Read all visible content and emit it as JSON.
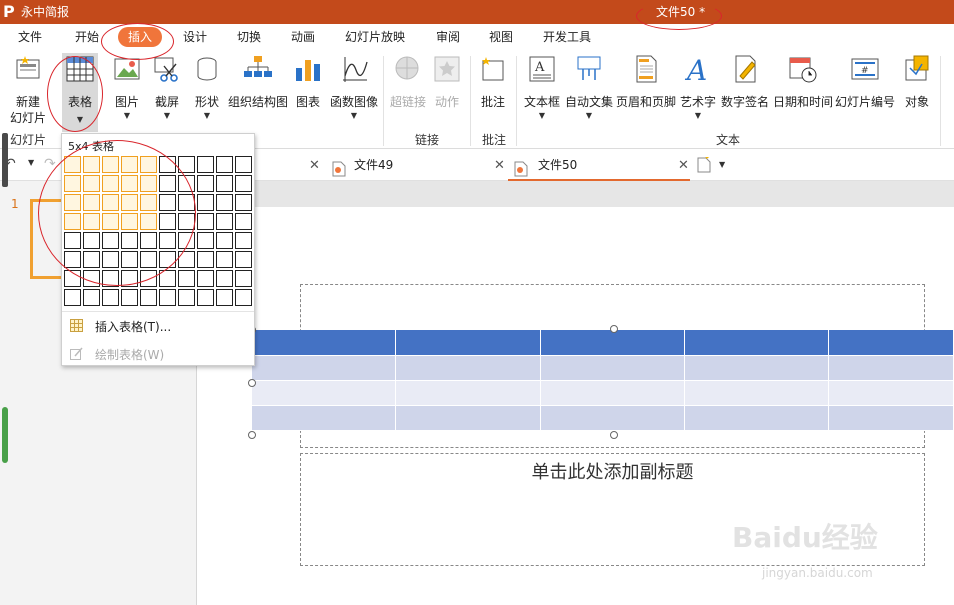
{
  "app": {
    "name": "永中简报",
    "document_title": "文件50 *"
  },
  "menu": {
    "tabs": [
      "文件",
      "开始",
      "插入",
      "设计",
      "切换",
      "动画",
      "幻灯片放映",
      "审阅",
      "视图",
      "开发工具"
    ],
    "active": "插入"
  },
  "ribbon": {
    "new_slide_line1": "新建",
    "new_slide_line2": "幻灯片",
    "table": "表格",
    "picture": "图片",
    "screenshot": "截屏",
    "shape": "形状",
    "smartart": "组织结构图",
    "chart": "图表",
    "function_graph": "函数图像",
    "hyperlink": "超链接",
    "action": "动作",
    "comment": "批注",
    "textbox": "文本框",
    "autotext": "自动文集",
    "header_footer": "页眉和页脚",
    "wordart": "艺术字",
    "signature": "数字签名",
    "datetime": "日期和时间",
    "slide_number": "幻灯片编号",
    "object": "对象",
    "groups": {
      "slides": "幻灯片",
      "links": "链接",
      "comments": "批注",
      "text": "文本"
    }
  },
  "doc_tabs": [
    {
      "label": "文件49"
    },
    {
      "label": "文件50"
    }
  ],
  "slide_number": "1",
  "table_dropdown": {
    "header": "5x4 表格",
    "grid": {
      "cols": 10,
      "rows": 8,
      "selected_cols": 5,
      "selected_rows": 4
    },
    "insert_table": "插入表格(T)...",
    "draw_table": "绘制表格(W)"
  },
  "slide": {
    "subtitle_placeholder": "单击此处添加副标题",
    "colors": {
      "header_row": "#4472c4",
      "row_dark": "#cfd5ea",
      "row_light": "#e9ebf5"
    }
  },
  "watermark": {
    "line1": "Baidu经验",
    "line2": "jingyan.baidu.com"
  },
  "colors": {
    "titlebar": "#c34a1b",
    "accent": "#f0753b",
    "annotation": "#d9262c"
  }
}
